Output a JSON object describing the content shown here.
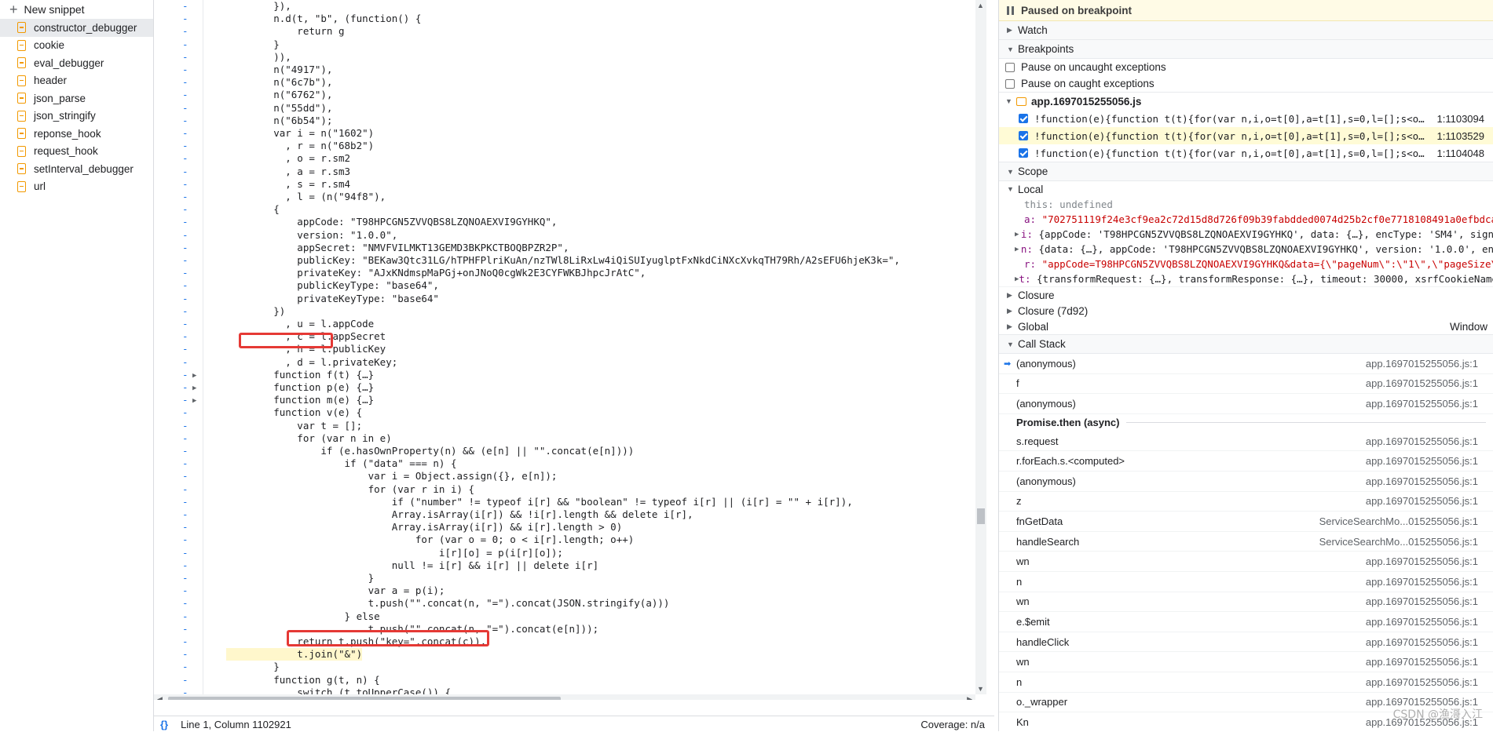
{
  "snippets": {
    "new_label": "New snippet",
    "items": [
      "constructor_debugger",
      "cookie",
      "eval_debugger",
      "header",
      "json_parse",
      "json_stringify",
      "reponse_hook",
      "request_hook",
      "setInterval_debugger",
      "url"
    ],
    "selected": 0
  },
  "editor": {
    "lines": [
      {
        "t": "        }),",
        "f": ""
      },
      {
        "t": "        n.d(t, \"b\", (function() {",
        "f": ""
      },
      {
        "t": "            return g",
        "f": ""
      },
      {
        "t": "        }",
        "f": ""
      },
      {
        "t": "        )),",
        "f": ""
      },
      {
        "t": "        n(\"4917\"),",
        "f": ""
      },
      {
        "t": "        n(\"6c7b\"),",
        "f": ""
      },
      {
        "t": "        n(\"6762\"),",
        "f": ""
      },
      {
        "t": "        n(\"55dd\"),",
        "f": ""
      },
      {
        "t": "        n(\"6b54\");",
        "f": ""
      },
      {
        "t": "        var i = n(\"1602\")",
        "f": ""
      },
      {
        "t": "          , r = n(\"68b2\")",
        "f": ""
      },
      {
        "t": "          , o = r.sm2",
        "f": ""
      },
      {
        "t": "          , a = r.sm3",
        "f": ""
      },
      {
        "t": "          , s = r.sm4",
        "f": ""
      },
      {
        "t": "          , l = (n(\"94f8\"),",
        "f": ""
      },
      {
        "t": "        {",
        "f": ""
      },
      {
        "t": "            appCode: \"T98HPCGN5ZVVQBS8LZQNOAEXVI9GYHKQ\",",
        "f": ""
      },
      {
        "t": "            version: \"1.0.0\",",
        "f": ""
      },
      {
        "t": "            appSecret: \"NMVFVILMKT13GEMD3BKPKCTBOQBPZR2P\",",
        "f": ""
      },
      {
        "t": "            publicKey: \"BEKaw3Qtc31LG/hTPHFPlriKuAn/nzTWl8LiRxLw4iQiSUIyuglptFxNkdCiNXcXvkqTH79Rh/A2sEFU6hjeK3k=\",",
        "f": ""
      },
      {
        "t": "            privateKey: \"AJxKNdmspMaPGj+onJNoQ0cgWk2E3CYFWKBJhpcJrAtC\",",
        "f": ""
      },
      {
        "t": "            publicKeyType: \"base64\",",
        "f": ""
      },
      {
        "t": "            privateKeyType: \"base64\"",
        "f": ""
      },
      {
        "t": "        })",
        "f": ""
      },
      {
        "t": "          , u = l.appCode",
        "f": ""
      },
      {
        "t": "          , c = l.appSecret",
        "f": ""
      },
      {
        "t": "          , h = l.publicKey",
        "f": ""
      },
      {
        "t": "          , d = l.privateKey;",
        "f": ""
      },
      {
        "t": "        function f(t) {…}",
        "f": "▶"
      },
      {
        "t": "        function p(e) {…}",
        "f": "▶"
      },
      {
        "t": "        function m(e) {…}",
        "f": "▶"
      },
      {
        "t": "        function v(e) {",
        "f": ""
      },
      {
        "t": "            var t = [];",
        "f": ""
      },
      {
        "t": "            for (var n in e)",
        "f": ""
      },
      {
        "t": "                if (e.hasOwnProperty(n) && (e[n] || \"\".concat(e[n])))",
        "f": ""
      },
      {
        "t": "                    if (\"data\" === n) {",
        "f": ""
      },
      {
        "t": "                        var i = Object.assign({}, e[n]);",
        "f": ""
      },
      {
        "t": "                        for (var r in i) {",
        "f": ""
      },
      {
        "t": "                            if (\"number\" != typeof i[r] && \"boolean\" != typeof i[r] || (i[r] = \"\" + i[r]),",
        "f": ""
      },
      {
        "t": "                            Array.isArray(i[r]) && !i[r].length && delete i[r],",
        "f": ""
      },
      {
        "t": "                            Array.isArray(i[r]) && i[r].length > 0)",
        "f": ""
      },
      {
        "t": "                                for (var o = 0; o < i[r].length; o++)",
        "f": ""
      },
      {
        "t": "                                    i[r][o] = p(i[r][o]);",
        "f": ""
      },
      {
        "t": "                            null != i[r] && i[r] || delete i[r]",
        "f": ""
      },
      {
        "t": "                        }",
        "f": ""
      },
      {
        "t": "                        var a = p(i);",
        "f": ""
      },
      {
        "t": "                        t.push(\"\".concat(n, \"=\").concat(JSON.stringify(a)))",
        "f": ""
      },
      {
        "t": "                    } else",
        "f": ""
      },
      {
        "t": "                        t.push(\"\".concat(n, \"=\").concat(e[n]));",
        "f": ""
      },
      {
        "t": "            return t.push(\"key=\".concat(c)),",
        "f": ""
      },
      {
        "t": "            t.join(\"&\")",
        "f": ""
      },
      {
        "t": "        }",
        "f": ""
      },
      {
        "t": "        function g(t, n) {",
        "f": ""
      },
      {
        "t": "            switch (t.toUpperCase()) {",
        "f": ""
      }
    ]
  },
  "status_bar": {
    "braces": "{}",
    "position": "Line 1, Column 1102921",
    "coverage": "Coverage: n/a"
  },
  "debugger": {
    "paused": "Paused on breakpoint",
    "watch": "Watch",
    "breakpoints_title": "Breakpoints",
    "pause_uncaught": "Pause on uncaught exceptions",
    "pause_caught": "Pause on caught exceptions",
    "bp_file": "app.1697015255056.js",
    "breakpoints": [
      {
        "code": "!function(e){function t(t){for(var n,i,o=t[0],a=t[1],s=0,l=[];s<o…",
        "loc": "1:1103094"
      },
      {
        "code": "!function(e){function t(t){for(var n,i,o=t[0],a=t[1],s=0,l=[];s<o…",
        "loc": "1:1103529"
      },
      {
        "code": "!function(e){function t(t){for(var n,i,o=t[0],a=t[1],s=0,l=[];s<o…",
        "loc": "1:1104048"
      }
    ],
    "scope_title": "Scope",
    "local_title": "Local",
    "this_label": "this:",
    "this_value": "undefined",
    "scope_vars": {
      "a_key": "a:",
      "a_val": "\"702751119f24e3cf9ea2c72d15d8d726f09b39fabdded0074d25b2cf0e7718108491a0efbdca",
      "i_key": "i:",
      "i_val": "{appCode: 'T98HPCGN5ZVVQBS8LZQNOAEXVI9GYHKQ', data: {…}, encType: 'SM4', sign",
      "n_key": "n:",
      "n_val": "{data: {…}, appCode: 'T98HPCGN5ZVVQBS8LZQNOAEXVI9GYHKQ', version: '1.0.0', en",
      "r_key": "r:",
      "r_val": "\"appCode=T98HPCGN5ZVVQBS8LZQNOAEXVI9GYHKQ&data={\\\"pageNum\\\":\\\"1\\\",\\\"pageSize\\",
      "t_key": "t:",
      "t_val": "{transformRequest: {…}, transformResponse: {…}, timeout: 30000, xsrfCookieName"
    },
    "closure": "Closure",
    "closure2": "Closure (7d92)",
    "global": "Global",
    "global_val": "Window",
    "callstack_title": "Call Stack",
    "callstack_before": [
      {
        "fn": "(anonymous)",
        "loc": "app.1697015255056.js:1"
      },
      {
        "fn": "f",
        "loc": "app.1697015255056.js:1"
      },
      {
        "fn": "(anonymous)",
        "loc": "app.1697015255056.js:1"
      }
    ],
    "async_label": "Promise.then (async)",
    "callstack_after": [
      {
        "fn": "s.request",
        "loc": "app.1697015255056.js:1"
      },
      {
        "fn": "r.forEach.s.<computed>",
        "loc": "app.1697015255056.js:1"
      },
      {
        "fn": "(anonymous)",
        "loc": "app.1697015255056.js:1"
      },
      {
        "fn": "z",
        "loc": "app.1697015255056.js:1"
      },
      {
        "fn": "fnGetData",
        "loc": "ServiceSearchMo...015255056.js:1"
      },
      {
        "fn": "handleSearch",
        "loc": "ServiceSearchMo...015255056.js:1"
      },
      {
        "fn": "wn",
        "loc": "app.1697015255056.js:1"
      },
      {
        "fn": "n",
        "loc": "app.1697015255056.js:1"
      },
      {
        "fn": "wn",
        "loc": "app.1697015255056.js:1"
      },
      {
        "fn": "e.$emit",
        "loc": "app.1697015255056.js:1"
      },
      {
        "fn": "handleClick",
        "loc": "app.1697015255056.js:1"
      },
      {
        "fn": "wn",
        "loc": "app.1697015255056.js:1"
      },
      {
        "fn": "n",
        "loc": "app.1697015255056.js:1"
      },
      {
        "fn": "o._wrapper",
        "loc": "app.1697015255056.js:1"
      },
      {
        "fn": "Kn",
        "loc": "app.1697015255056.js:1"
      }
    ],
    "watermark": "CSDN @渔滒入江"
  }
}
